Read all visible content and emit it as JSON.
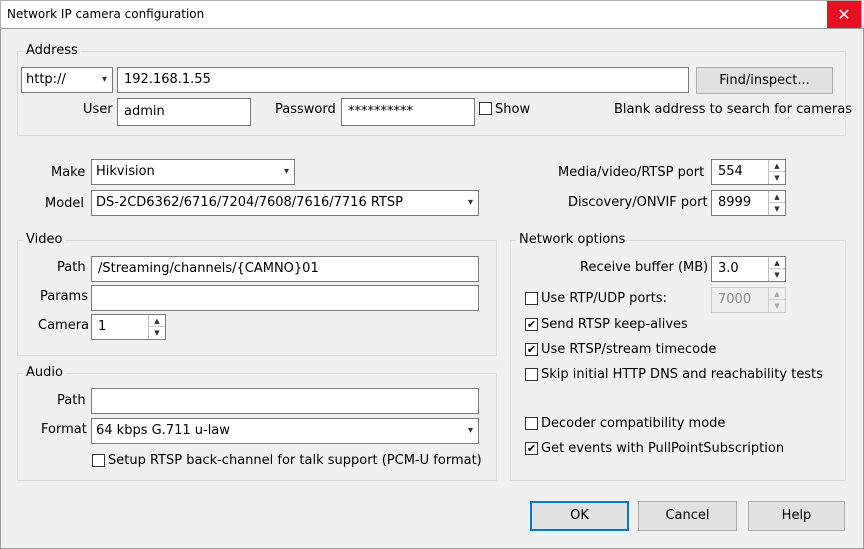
{
  "window": {
    "title": "Network IP camera configuration",
    "close_glyph": "✕"
  },
  "address": {
    "group_title": "Address",
    "protocol": "http://",
    "host": "192.168.1.55",
    "find_label": "Find/inspect...",
    "user_label": "User",
    "user_value": "admin",
    "password_label": "Password",
    "password_value": "**********",
    "show_label": "Show",
    "hint": "Blank address to search for cameras"
  },
  "device": {
    "make_label": "Make",
    "make_value": "Hikvision",
    "model_label": "Model",
    "model_value": "DS-2CD6362/6716/7204/7608/7616/7716 RTSP",
    "media_port_label": "Media/video/RTSP port",
    "media_port_value": "554",
    "discovery_port_label": "Discovery/ONVIF port",
    "discovery_port_value": "8999"
  },
  "video": {
    "group_title": "Video",
    "path_label": "Path",
    "path_value": "/Streaming/channels/{CAMNO}01",
    "params_label": "Params",
    "params_value": "",
    "camera_label": "Camera",
    "camera_value": "1"
  },
  "audio": {
    "group_title": "Audio",
    "path_label": "Path",
    "path_value": "",
    "format_label": "Format",
    "format_value": "64 kbps G.711 u-law",
    "backchannel_label": "Setup RTSP back-channel for talk support (PCM-U format)"
  },
  "network": {
    "group_title": "Network options",
    "buffer_label": "Receive buffer (MB)",
    "buffer_value": "3.0",
    "rtp_label": "Use RTP/UDP ports:",
    "rtp_value": "7000",
    "keepalive_label": "Send RTSP keep-alives",
    "timecode_label": "Use RTSP/stream timecode",
    "skip_label": "Skip initial HTTP DNS and reachability tests",
    "decoder_label": "Decoder compatibility mode",
    "events_label": "Get events with PullPointSubscription"
  },
  "buttons": {
    "ok": "OK",
    "cancel": "Cancel",
    "help": "Help"
  },
  "glyphs": {
    "check": "✔",
    "chevron": "▾",
    "up": "▲",
    "down": "▼"
  }
}
